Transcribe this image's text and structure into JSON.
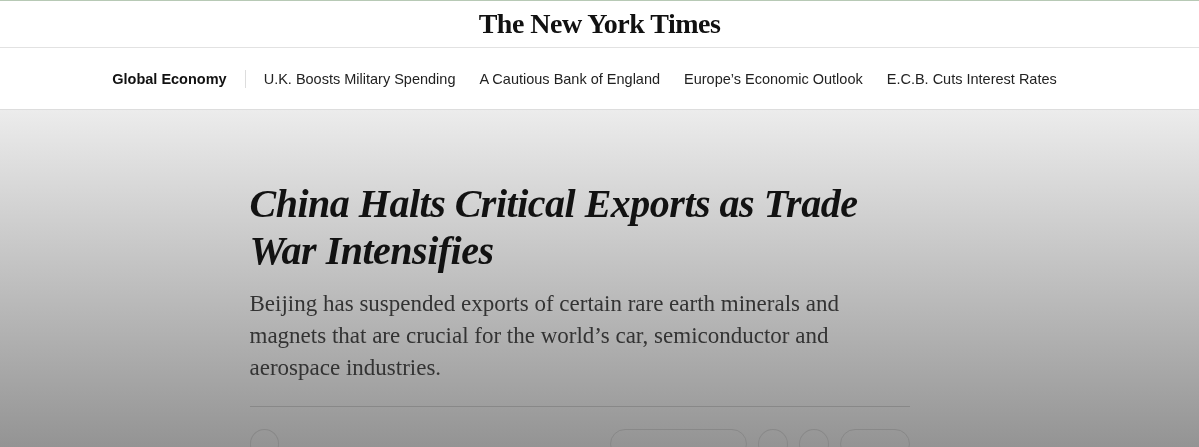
{
  "masthead": {
    "logo": "The New York Times"
  },
  "nav": {
    "section": "Global Economy",
    "links": [
      "U.K. Boosts Military Spending",
      "A Cautious Bank of England",
      "Europe’s Economic Outlook",
      "E.C.B. Cuts Interest Rates"
    ]
  },
  "article": {
    "headline": "China Halts Critical Exports as Trade War Intensifies",
    "summary": "Beijing has suspended exports of certain rare earth minerals and magnets that are crucial for the world’s car, semiconductor and aerospace industries.",
    "controls": [
      {
        "kind": "circle"
      },
      {
        "kind": "pill"
      },
      {
        "kind": "circle"
      },
      {
        "kind": "circle"
      },
      {
        "kind": "pill"
      }
    ]
  }
}
